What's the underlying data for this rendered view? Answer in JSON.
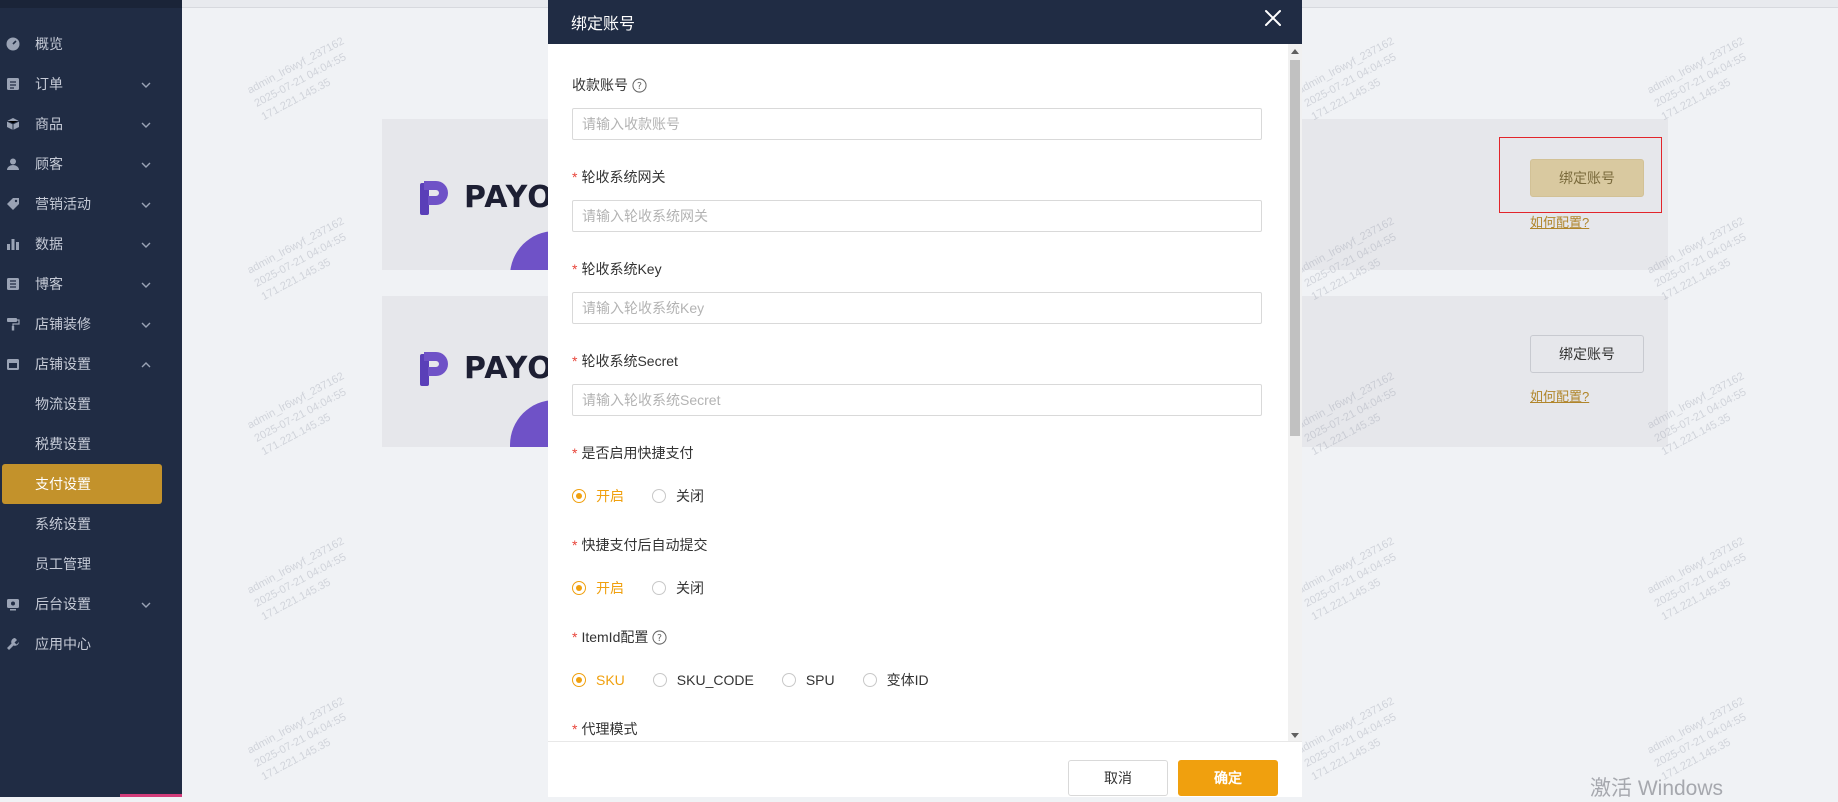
{
  "sidebar": {
    "items": [
      {
        "label": "概览",
        "icon": "dashboard-icon",
        "expandable": false
      },
      {
        "label": "订单",
        "icon": "order-icon",
        "expandable": true
      },
      {
        "label": "商品",
        "icon": "box-icon",
        "expandable": true
      },
      {
        "label": "顾客",
        "icon": "user-icon",
        "expandable": true
      },
      {
        "label": "营销活动",
        "icon": "tag-icon",
        "expandable": true
      },
      {
        "label": "数据",
        "icon": "bar-chart-icon",
        "expandable": true
      },
      {
        "label": "博客",
        "icon": "blog-icon",
        "expandable": true
      },
      {
        "label": "店铺装修",
        "icon": "paint-roller-icon",
        "expandable": true
      },
      {
        "label": "店铺设置",
        "icon": "store-icon",
        "expandable": true,
        "expanded": true
      }
    ],
    "submenu": [
      {
        "label": "物流设置"
      },
      {
        "label": "税费设置"
      },
      {
        "label": "支付设置",
        "active": true
      },
      {
        "label": "系统设置"
      },
      {
        "label": "员工管理"
      }
    ],
    "bottom_items": [
      {
        "label": "后台设置",
        "icon": "admin-icon",
        "expandable": true
      },
      {
        "label": "应用中心",
        "icon": "wrench-icon",
        "expandable": false
      }
    ]
  },
  "background": {
    "cards": [
      {
        "logo_text": "PAYO",
        "bind_label": "绑定账号",
        "howto_label": "如何配置?",
        "highlighted": true
      },
      {
        "logo_text": "PAYO",
        "bind_label": "绑定账号",
        "howto_label": "如何配置?",
        "highlighted": false
      }
    ],
    "watermark_lines": [
      "admin_lr6wyf_237162",
      "2025-07-21 04:04:55",
      "171.221.145.35"
    ],
    "windows_activation": "激活 Windows"
  },
  "modal": {
    "title": "绑定账号",
    "fields": [
      {
        "label": "收款账号",
        "required": false,
        "help": true,
        "placeholder": "请输入收款账号",
        "value": ""
      },
      {
        "label": "轮收系统网关",
        "required": true,
        "help": false,
        "placeholder": "请输入轮收系统网关",
        "value": ""
      },
      {
        "label": "轮收系统Key",
        "required": true,
        "help": false,
        "placeholder": "请输入轮收系统Key",
        "value": ""
      },
      {
        "label": "轮收系统Secret",
        "required": true,
        "help": false,
        "placeholder": "请输入轮收系统Secret",
        "value": ""
      }
    ],
    "radio_groups": [
      {
        "label": "是否启用快捷支付",
        "required": true,
        "help": false,
        "options": [
          "开启",
          "关闭"
        ],
        "selected": "开启"
      },
      {
        "label": "快捷支付后自动提交",
        "required": true,
        "help": false,
        "options": [
          "开启",
          "关闭"
        ],
        "selected": "开启"
      },
      {
        "label": "ItemId配置",
        "required": true,
        "help": true,
        "options": [
          "SKU",
          "SKU_CODE",
          "SPU",
          "变体ID"
        ],
        "selected": "SKU"
      }
    ],
    "last_label": {
      "label": "代理模式",
      "required": true
    },
    "cancel_label": "取消",
    "ok_label": "确定"
  },
  "colors": {
    "sidebar_bg": "#202c44",
    "accent": "#f0a00e",
    "active_menu": "#c3922b",
    "required": "#e8443a"
  }
}
